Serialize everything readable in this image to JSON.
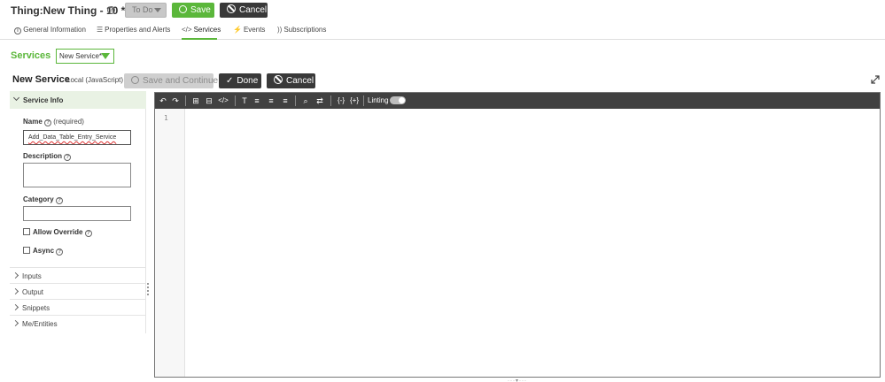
{
  "header": {
    "title": "Thing:New Thing - 10 *",
    "state_label": "To Do",
    "save_label": "Save",
    "cancel_label": "Cancel"
  },
  "tabs": [
    {
      "label": "General Information",
      "icon": "info-icon"
    },
    {
      "label": "Properties and Alerts",
      "icon": "list-icon"
    },
    {
      "label": "Services",
      "icon": "code-icon",
      "active": true
    },
    {
      "label": "Events",
      "icon": "lightning-icon"
    },
    {
      "label": "Subscriptions",
      "icon": "signal-icon"
    }
  ],
  "services": {
    "label": "Services",
    "selected_service": "New Service*"
  },
  "service_editor": {
    "title": "New Service",
    "subtitle": "Local (JavaScript)",
    "save_continue_label": "Save and Continue",
    "done_label": "Done",
    "cancel_label": "Cancel"
  },
  "service_info": {
    "header": "Service Info",
    "name_label": "Name",
    "name_required": "(required)",
    "name_value": "Add_Data_Table_Entry_Service",
    "description_label": "Description",
    "description_value": "",
    "category_label": "Category",
    "category_value": "",
    "allow_override_label": "Allow Override",
    "allow_override_checked": false,
    "async_label": "Async",
    "async_checked": false
  },
  "sections": [
    "Inputs",
    "Output",
    "Snippets",
    "Me/Entities"
  ],
  "editor": {
    "linting_label": "Linting",
    "linting_enabled": true,
    "line_numbers": [
      "1"
    ]
  },
  "colors": {
    "accent_green": "#5bb73b",
    "dark_button": "#393939",
    "toolbar": "#414141"
  }
}
